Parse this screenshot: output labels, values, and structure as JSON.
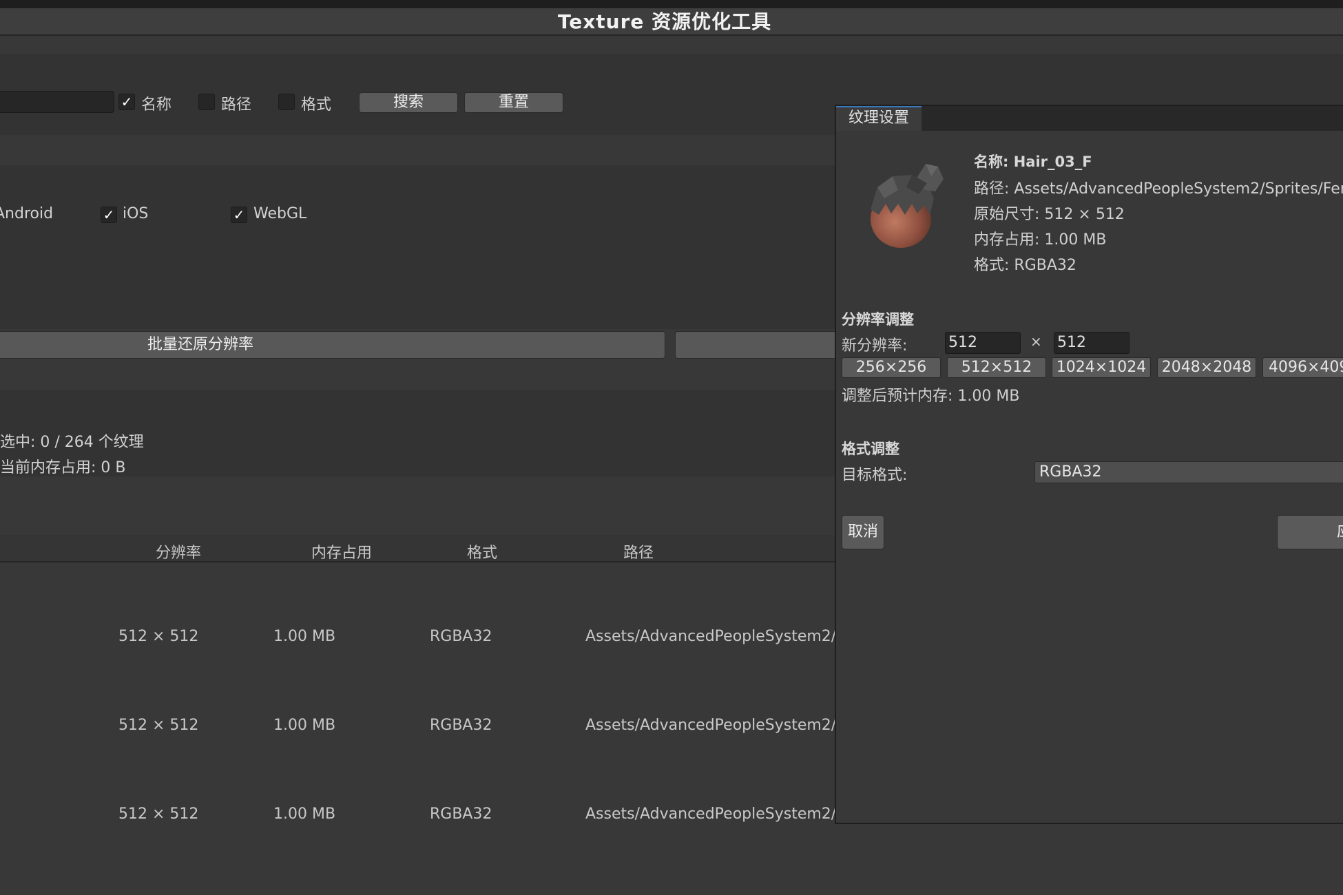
{
  "window": {
    "title": "Texture 资源优化工具"
  },
  "search": {
    "name_label": "名称",
    "name_checked": true,
    "path_label": "路径",
    "path_checked": false,
    "format_label": "格式",
    "format_checked": false,
    "search_button": "搜索",
    "reset_button": "重置"
  },
  "platforms": [
    {
      "label": "Android",
      "checked": true
    },
    {
      "label": "iOS",
      "checked": true
    },
    {
      "label": "WebGL",
      "checked": true
    }
  ],
  "batch": {
    "restore_button": "批量还原分辨率"
  },
  "stats": {
    "selected": "选中: 0 / 264 个纹理",
    "memory": "当前内存占用: 0 B"
  },
  "table": {
    "headers": [
      "分辨率",
      "内存占用",
      "格式",
      "路径"
    ],
    "rows": [
      {
        "resolution": "512 × 512",
        "memory": "1.00 MB",
        "format": "RGBA32",
        "path": "Assets/AdvancedPeopleSystem2/"
      },
      {
        "resolution": "512 × 512",
        "memory": "1.00 MB",
        "format": "RGBA32",
        "path": "Assets/AdvancedPeopleSystem2/"
      },
      {
        "resolution": "512 × 512",
        "memory": "1.00 MB",
        "format": "RGBA32",
        "path": "Assets/AdvancedPeopleSystem2/"
      }
    ]
  },
  "dialog": {
    "tab": "纹理设置",
    "info": {
      "name": "名称: Hair_03_F",
      "path": "路径: Assets/AdvancedPeopleSystem2/Sprites/Fem",
      "original_size": "原始尺寸: 512 × 512",
      "memory": "内存占用: 1.00 MB",
      "format": "格式: RGBA32"
    },
    "resolution": {
      "heading": "分辨率调整",
      "new_label": "新分辨率:",
      "width": "512",
      "times": "×",
      "height": "512",
      "presets": [
        "256×256",
        "512×512",
        "1024×1024",
        "2048×2048",
        "4096×409"
      ],
      "estimate": "调整后预计内存: 1.00 MB"
    },
    "format": {
      "heading": "格式调整",
      "target_label": "目标格式:",
      "target_value": "RGBA32"
    },
    "cancel_button": "取消",
    "apply_button_partial": "应"
  }
}
